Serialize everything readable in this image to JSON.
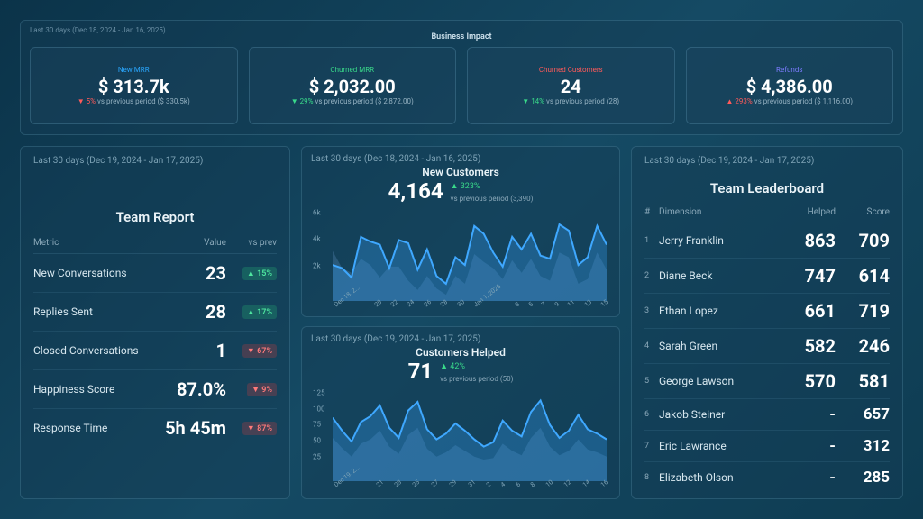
{
  "impact": {
    "range": "Last 30 days (Dec 18, 2024 - Jan 16, 2025)",
    "title": "Business Impact",
    "cards": [
      {
        "name": "New MRR",
        "name_class": "c-blue",
        "value": "$ 313.7k",
        "dir": "down",
        "delta": "5%",
        "delta_class": "c-red",
        "prev_suffix": " vs previous period ($ 330.5k)"
      },
      {
        "name": "Churned MRR",
        "name_class": "c-green",
        "value": "$ 2,032.00",
        "dir": "down",
        "delta": "29%",
        "delta_class": "c-green",
        "prev_suffix": " vs previous period ($ 2,872.00)"
      },
      {
        "name": "Churned Customers",
        "name_class": "c-red",
        "value": "24",
        "dir": "down",
        "delta": "14%",
        "delta_class": "c-green",
        "prev_suffix": " vs previous period (28)"
      },
      {
        "name": "Refunds",
        "name_class": "c-purple",
        "value": "$ 4,386.00",
        "dir": "up",
        "delta": "293%",
        "delta_class": "c-red",
        "prev_suffix": " vs previous period ($ 1,116.00)"
      }
    ]
  },
  "report": {
    "range": "Last 30 days (Dec 19, 2024 - Jan 17, 2025)",
    "title": "Team Report",
    "head": {
      "metric": "Metric",
      "value": "Value",
      "prev": "vs prev"
    },
    "rows": [
      {
        "metric": "New Conversations",
        "value": "23",
        "dir": "up",
        "delta": "15%"
      },
      {
        "metric": "Replies Sent",
        "value": "28",
        "dir": "up",
        "delta": "17%"
      },
      {
        "metric": "Closed Conversations",
        "value": "1",
        "dir": "down",
        "delta": "67%"
      },
      {
        "metric": "Happiness Score",
        "value": "87.0%",
        "dir": "down",
        "delta": "9%"
      },
      {
        "metric": "Response Time",
        "value": "5h 45m",
        "dir": "down",
        "delta": "87%"
      }
    ]
  },
  "chart_data": [
    {
      "id": "new_customers",
      "type": "area",
      "range": "Last 30 days (Dec 18, 2024 - Jan 16, 2025)",
      "title": "New Customers",
      "big": "4,164",
      "delta_dir": "up",
      "delta": "323%",
      "delta_class": "c-green",
      "prev": "vs previous period (3,390)",
      "ylim": [
        0,
        6000
      ],
      "yticks": [
        "6k",
        "4k",
        "2k"
      ],
      "categories": [
        "Dec 18, 2...",
        "20",
        "22",
        "24",
        "26",
        "28",
        "30",
        "Jan 1, 2025",
        "3",
        "5",
        "7",
        "9",
        "11",
        "13",
        "15"
      ],
      "series": [
        {
          "name": "current",
          "values": [
            2300,
            2100,
            1500,
            4100,
            3800,
            3600,
            2100,
            3900,
            3700,
            2000,
            3300,
            1600,
            1100,
            2800,
            2300,
            4800,
            4300,
            3100,
            2200,
            4100,
            3300,
            4300,
            2900,
            2700,
            4900,
            4500,
            2300,
            2800,
            4800,
            3600
          ]
        },
        {
          "name": "previous",
          "values": [
            3200,
            2100,
            1800,
            2700,
            2300,
            1500,
            2200,
            2200,
            1300,
            700,
            1600,
            800,
            400,
            1600,
            1100,
            3000,
            2500,
            2100,
            1400,
            2600,
            1800,
            2700,
            1600,
            1300,
            3100,
            2800,
            1100,
            1400,
            3100,
            2000
          ]
        }
      ]
    },
    {
      "id": "customers_helped",
      "type": "area",
      "range": "Last 30 days (Dec 19, 2024 - Jan 17, 2025)",
      "title": "Customers Helped",
      "big": "71",
      "delta_dir": "up",
      "delta": "42%",
      "delta_class": "c-green",
      "prev": "vs previous period (50)",
      "ylim": [
        0,
        130
      ],
      "yticks": [
        "125",
        "100",
        "75",
        "50",
        "25"
      ],
      "categories": [
        "Dec 19, 2...",
        "21",
        "23",
        "25",
        "27",
        "29",
        "31",
        "2",
        "4",
        "6",
        "8",
        "10",
        "12",
        "14",
        "16"
      ],
      "series": [
        {
          "name": "current",
          "values": [
            88,
            70,
            55,
            82,
            90,
            105,
            74,
            60,
            98,
            110,
            72,
            58,
            66,
            80,
            70,
            58,
            48,
            54,
            84,
            70,
            62,
            96,
            112,
            78,
            60,
            70,
            92,
            72,
            66,
            58
          ]
        },
        {
          "name": "previous",
          "values": [
            60,
            46,
            34,
            52,
            58,
            70,
            48,
            38,
            64,
            74,
            45,
            34,
            40,
            50,
            42,
            34,
            30,
            32,
            52,
            42,
            36,
            60,
            74,
            48,
            36,
            42,
            58,
            44,
            40,
            34
          ]
        }
      ]
    }
  ],
  "board": {
    "range": "Last 30 days (Dec 19, 2024 - Jan 17, 2025)",
    "title": "Team Leaderboard",
    "head": {
      "n": "#",
      "d": "Dimension",
      "h": "Helped",
      "s": "Score"
    },
    "rows": [
      {
        "n": "1",
        "d": "Jerry Franklin",
        "h": "863",
        "s": "709"
      },
      {
        "n": "2",
        "d": "Diane Beck",
        "h": "747",
        "s": "614"
      },
      {
        "n": "3",
        "d": "Ethan Lopez",
        "h": "661",
        "s": "719"
      },
      {
        "n": "4",
        "d": "Sarah Green",
        "h": "582",
        "s": "246"
      },
      {
        "n": "5",
        "d": "George Lawson",
        "h": "570",
        "s": "581"
      },
      {
        "n": "6",
        "d": "Jakob Steiner",
        "h": "-",
        "s": "657"
      },
      {
        "n": "7",
        "d": "Eric Lawrance",
        "h": "-",
        "s": "312"
      },
      {
        "n": "8",
        "d": "Elizabeth Olson",
        "h": "-",
        "s": "285"
      }
    ]
  }
}
